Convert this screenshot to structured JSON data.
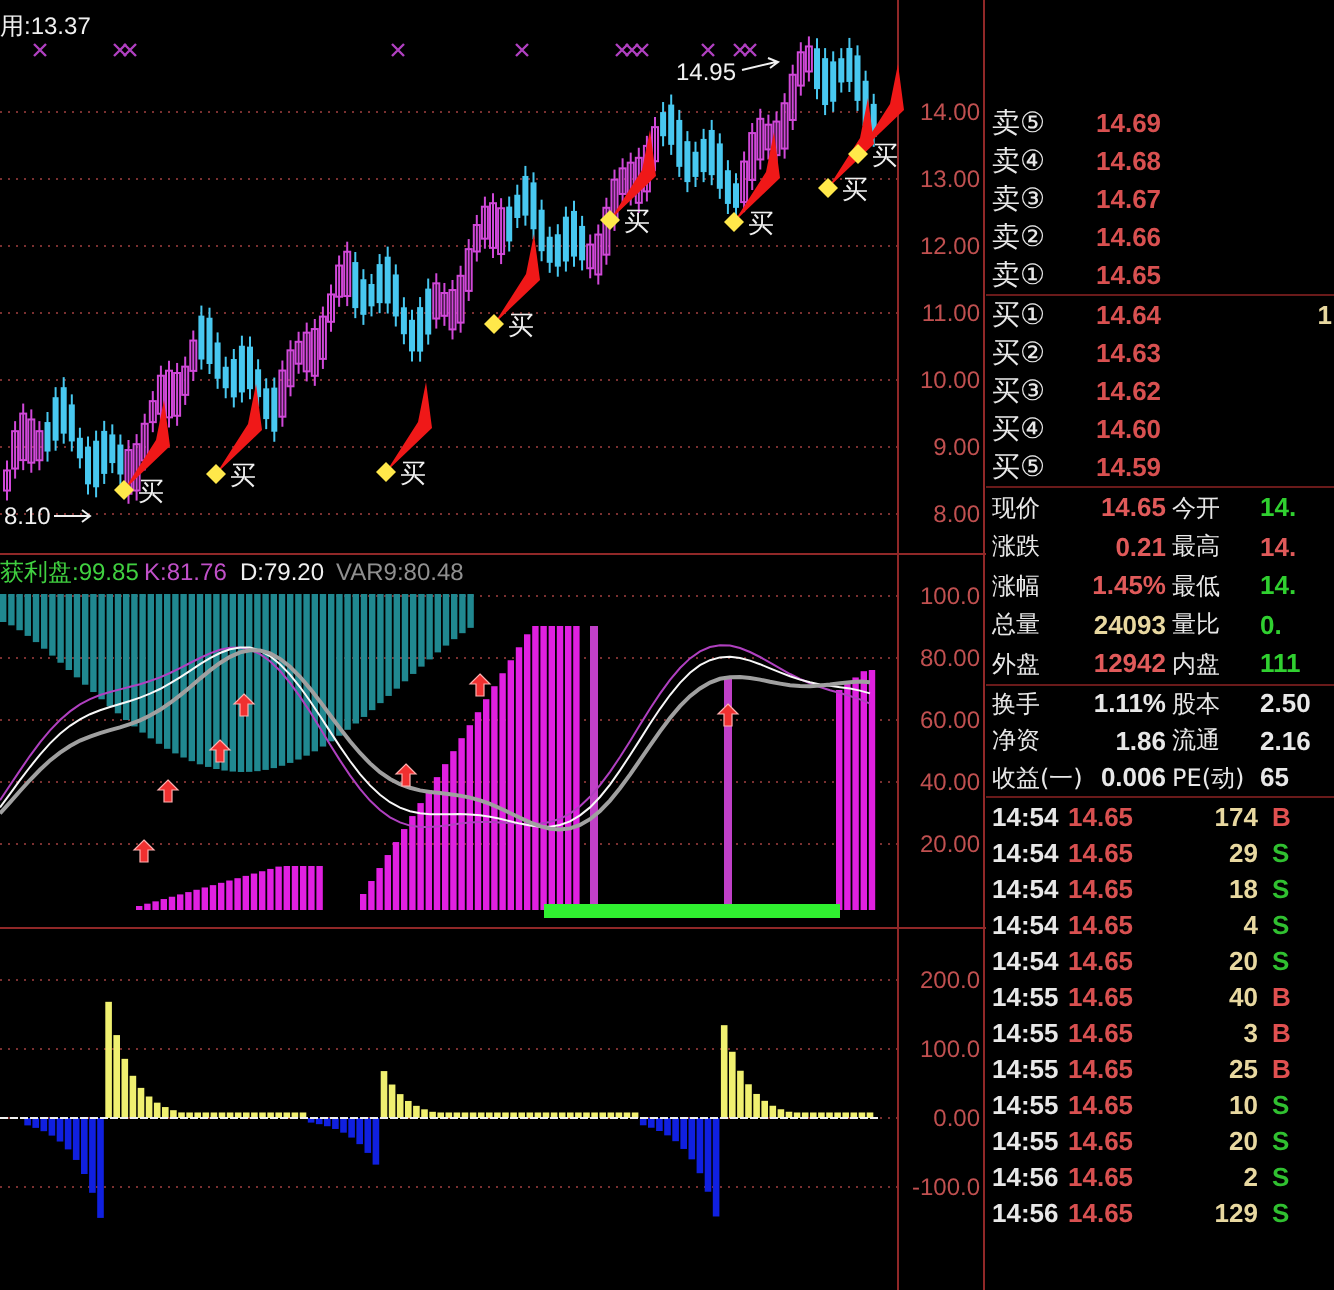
{
  "price_chart": {
    "top_label": "用:13.37",
    "high_label": "14.95",
    "low_label": "8.10",
    "buy_signals": [
      {
        "label": "买"
      },
      {
        "label": "买"
      },
      {
        "label": "买"
      },
      {
        "label": "买"
      },
      {
        "label": "买"
      },
      {
        "label": "买"
      },
      {
        "label": "买"
      },
      {
        "label": "买"
      }
    ],
    "y_axis": [
      "14.00",
      "13.00",
      "12.00",
      "11.00",
      "10.00",
      "9.00",
      "8.00"
    ]
  },
  "indicator_chart": {
    "legend": [
      {
        "text": "获利盘:99.85",
        "color": "#40d040"
      },
      {
        "text": "K:81.76",
        "color": "#c050c8"
      },
      {
        "text": "D:79.20",
        "color": "#f0f0f0"
      },
      {
        "text": "VAR9:80.48",
        "color": "#909090"
      }
    ],
    "y_axis": [
      "100.0",
      "80.00",
      "60.00",
      "40.00",
      "20.00"
    ]
  },
  "volume_chart": {
    "y_axis": [
      "200.0",
      "100.0",
      "0.00",
      "-100.0"
    ]
  },
  "order_book": {
    "asks": [
      {
        "label": "卖⑤",
        "price": "14.69"
      },
      {
        "label": "卖④",
        "price": "14.68"
      },
      {
        "label": "卖③",
        "price": "14.67"
      },
      {
        "label": "卖②",
        "price": "14.66"
      },
      {
        "label": "卖①",
        "price": "14.65"
      }
    ],
    "bids": [
      {
        "label": "买①",
        "price": "14.64",
        "volume": "1"
      },
      {
        "label": "买②",
        "price": "14.63"
      },
      {
        "label": "买③",
        "price": "14.62"
      },
      {
        "label": "买④",
        "price": "14.60"
      },
      {
        "label": "买⑤",
        "price": "14.59"
      }
    ]
  },
  "quote": [
    {
      "cells": [
        {
          "text": "现价",
          "kind": "label"
        },
        {
          "text": "14.65",
          "kind": "rise"
        },
        {
          "text": "今开",
          "kind": "label"
        },
        {
          "text": "14.",
          "kind": "fall"
        }
      ]
    },
    {
      "cells": [
        {
          "text": "涨跌",
          "kind": "label"
        },
        {
          "text": "0.21",
          "kind": "rise"
        },
        {
          "text": "最高",
          "kind": "label"
        },
        {
          "text": "14.",
          "kind": "rise"
        }
      ]
    },
    {
      "cells": [
        {
          "text": "涨幅",
          "kind": "label"
        },
        {
          "text": "1.45%",
          "kind": "rise"
        },
        {
          "text": "最低",
          "kind": "label"
        },
        {
          "text": "14.",
          "kind": "fall"
        }
      ]
    },
    {
      "cells": [
        {
          "text": "总量",
          "kind": "label"
        },
        {
          "text": "24093",
          "kind": "volume"
        },
        {
          "text": "量比",
          "kind": "label"
        },
        {
          "text": "0.",
          "kind": "fall"
        }
      ]
    },
    {
      "cells": [
        {
          "text": "外盘",
          "kind": "label"
        },
        {
          "text": "12942",
          "kind": "rise"
        },
        {
          "text": "内盘",
          "kind": "label"
        },
        {
          "text": "111",
          "kind": "fall"
        }
      ]
    }
  ],
  "fundamentals": [
    {
      "cells": [
        {
          "text": "换手",
          "kind": "label"
        },
        {
          "text": "1.11%",
          "kind": "plain"
        },
        {
          "text": "股本",
          "kind": "label"
        },
        {
          "text": "2.50",
          "kind": "plain"
        }
      ]
    },
    {
      "cells": [
        {
          "text": "净资",
          "kind": "label"
        },
        {
          "text": "1.86",
          "kind": "plain"
        },
        {
          "text": "流通",
          "kind": "label"
        },
        {
          "text": "2.16",
          "kind": "plain"
        }
      ]
    },
    {
      "cells": [
        {
          "text": "收益(一)",
          "kind": "label"
        },
        {
          "text": "0.006",
          "kind": "plain"
        },
        {
          "text": "PE(动)",
          "kind": "label"
        },
        {
          "text": "65",
          "kind": "plain"
        }
      ]
    }
  ],
  "trades": [
    {
      "time": "14:54",
      "price": "14.65",
      "volume": "174",
      "side": "B",
      "kind": "buy"
    },
    {
      "time": "14:54",
      "price": "14.65",
      "volume": "29",
      "side": "S",
      "kind": "sell"
    },
    {
      "time": "14:54",
      "price": "14.65",
      "volume": "18",
      "side": "S",
      "kind": "sell"
    },
    {
      "time": "14:54",
      "price": "14.65",
      "volume": "4",
      "side": "S",
      "kind": "sell"
    },
    {
      "time": "14:54",
      "price": "14.65",
      "volume": "20",
      "side": "S",
      "kind": "sell"
    },
    {
      "time": "14:55",
      "price": "14.65",
      "volume": "40",
      "side": "B",
      "kind": "buy"
    },
    {
      "time": "14:55",
      "price": "14.65",
      "volume": "3",
      "side": "B",
      "kind": "buy"
    },
    {
      "time": "14:55",
      "price": "14.65",
      "volume": "25",
      "side": "B",
      "kind": "buy"
    },
    {
      "time": "14:55",
      "price": "14.65",
      "volume": "10",
      "side": "S",
      "kind": "sell"
    },
    {
      "time": "14:55",
      "price": "14.65",
      "volume": "20",
      "side": "S",
      "kind": "sell"
    },
    {
      "time": "14:56",
      "price": "14.65",
      "volume": "2",
      "side": "S",
      "kind": "sell"
    },
    {
      "time": "14:56",
      "price": "14.65",
      "volume": "129",
      "side": "S",
      "kind": "sell"
    }
  ]
}
